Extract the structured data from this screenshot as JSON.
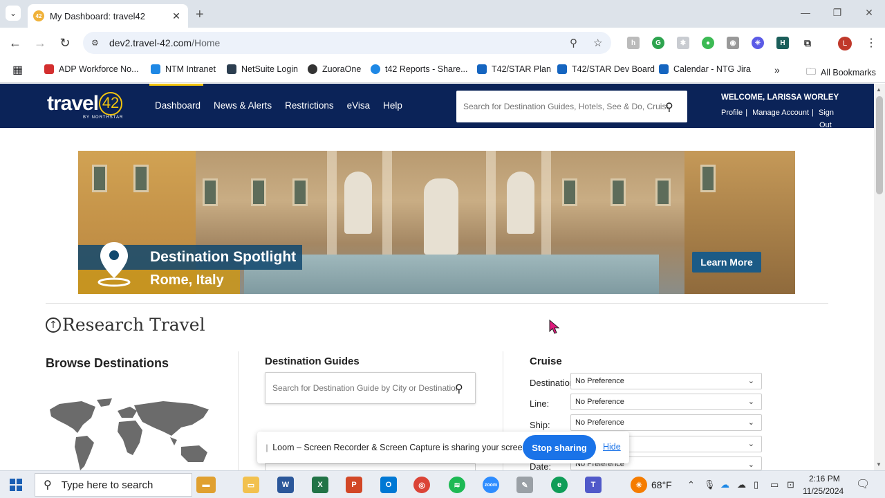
{
  "browser": {
    "tab_title": "My Dashboard: travel42",
    "url_host": "dev2.travel-42.com",
    "url_path": "/Home",
    "profile_initial": "L",
    "bookmarks": [
      {
        "label": "ADP Workforce No...",
        "color": "#d32f2f"
      },
      {
        "label": "NTM Intranet",
        "color": "#1e88e5"
      },
      {
        "label": "NetSuite Login",
        "color": "#2c3e50"
      },
      {
        "label": "ZuoraOne",
        "color": "#333333"
      },
      {
        "label": "t42 Reports - Share...",
        "color": "#1e88e5"
      },
      {
        "label": "T42/STAR Plan",
        "color": "#1565c0"
      },
      {
        "label": "T42/STAR Dev Board",
        "color": "#1565c0"
      },
      {
        "label": "Calendar - NTG Jira",
        "color": "#1565c0"
      }
    ],
    "all_bookmarks": "All Bookmarks"
  },
  "site": {
    "logo_text": "travel",
    "logo_number": "42",
    "logo_sub": "BY NORTHSTAR",
    "nav": [
      "Dashboard",
      "News & Alerts",
      "Restrictions",
      "eVisa",
      "Help"
    ],
    "search_placeholder": "Search for Destination Guides, Hotels, See & Do, Cruises",
    "welcome": "WELCOME, LARISSA WORLEY",
    "links": {
      "profile": "Profile",
      "manage": "Manage Account",
      "sign": "Sign",
      "out": "Out"
    }
  },
  "banner": {
    "title": "Destination Spotlight",
    "subtitle": "Rome, Italy",
    "cta": "Learn More"
  },
  "research": {
    "title": "Research Travel",
    "browse_title": "Browse Destinations",
    "guides_title": "Destination Guides",
    "guides_placeholder": "Search for Destination Guide by City or Destination",
    "cruise_title": "Cruise",
    "cruise_fields": [
      {
        "label": "Destination:",
        "value": "No Preference"
      },
      {
        "label": "Line:",
        "value": "No Preference"
      },
      {
        "label": "Ship:",
        "value": "No Preference"
      },
      {
        "label": "",
        "value": ""
      },
      {
        "label": "Date:",
        "value": "No Preference"
      }
    ]
  },
  "loom": {
    "message": "Loom – Screen Recorder & Screen Capture is sharing your screen.",
    "stop": "Stop sharing",
    "hide": "Hide"
  },
  "taskbar": {
    "search_placeholder": "Type here to search",
    "weather": "68°F",
    "time": "2:16 PM",
    "date": "11/25/2024"
  },
  "colors": {
    "header_bg": "#0b2358",
    "accent_gold": "#f1c40f",
    "loom_blue": "#1a73e8"
  }
}
